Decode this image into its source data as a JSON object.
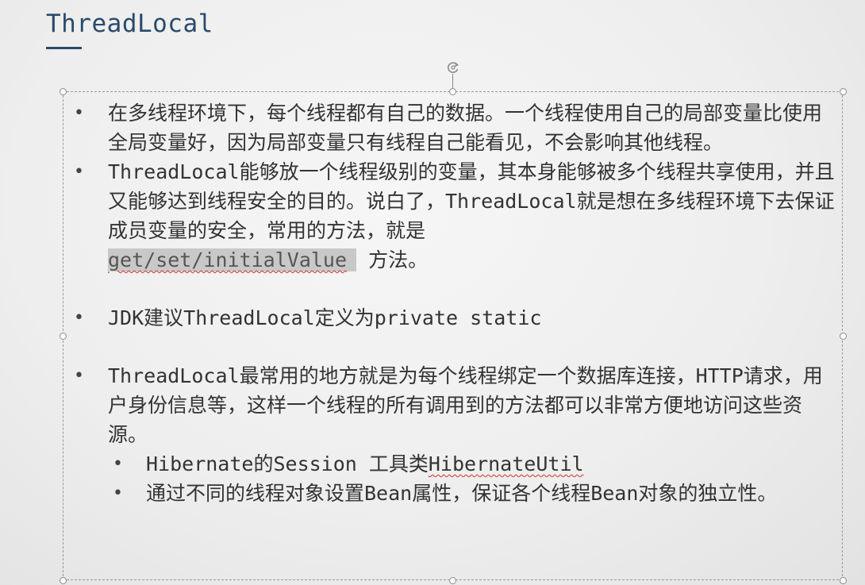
{
  "slide": {
    "title": "ThreadLocal",
    "bullets": {
      "b1": "在多线程环境下，每个线程都有自己的数据。一个线程使用自己的局部变量比使用全局变量好，因为局部变量只有线程自己能看见，不会影响其他线程。",
      "b2_text": "ThreadLocal能够放一个线程级别的变量，其本身能够被多个线程共享使用，并且又能够达到线程安全的目的。说白了，ThreadLocal就是想在多线程环境下去保证成员变量的安全，常用的方法，就是",
      "b2_code": "get/set/initialValue",
      "b2_tail": " 方法。",
      "b3": "JDK建议ThreadLocal定义为private static",
      "b4": "ThreadLocal最常用的地方就是为每个线程绑定一个数据库连接，HTTP请求，用户身份信息等，这样一个线程的所有调用到的方法都可以非常方便地访问这些资源。",
      "sub1_text": "Hibernate的Session 工具类",
      "sub1_code": "HibernateUtil",
      "sub2": "通过不同的线程对象设置Bean属性，保证各个线程Bean对象的独立性。"
    }
  },
  "icons": {
    "rotate": "rotate-handle-icon",
    "selection": "selection-handle"
  },
  "colors": {
    "title": "#2b4a6a",
    "text": "#333333",
    "highlight": "#c8c8c8",
    "spellcheck": "#d03030"
  }
}
